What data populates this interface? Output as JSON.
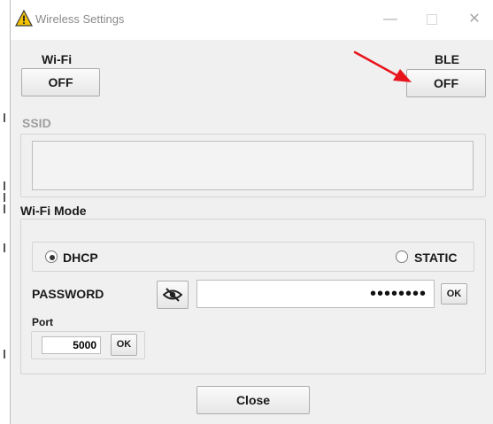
{
  "window": {
    "title": "Wireless Settings"
  },
  "wifi": {
    "label": "Wi-Fi",
    "button": "OFF"
  },
  "ble": {
    "label": "BLE",
    "button": "OFF"
  },
  "ssid": {
    "label": "SSID",
    "value": ""
  },
  "mode": {
    "label": "Wi-Fi Mode",
    "dhcp": "DHCP",
    "static": "STATIC",
    "selected": "DHCP"
  },
  "password": {
    "label": "PASSWORD",
    "value": "••••••••",
    "ok": "OK"
  },
  "port": {
    "label": "Port",
    "value": "5000",
    "ok": "OK"
  },
  "close": "Close",
  "annotation": {
    "color": "#e8141b"
  },
  "icons": {
    "app": "warning-triangle-icon",
    "visibility": "eye-slash-icon"
  }
}
